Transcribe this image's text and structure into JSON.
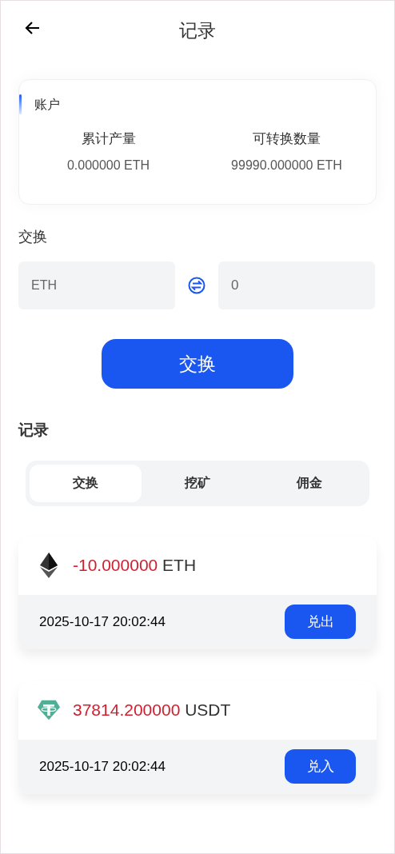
{
  "header": {
    "title": "记录"
  },
  "account": {
    "title": "账户",
    "stats": [
      {
        "label": "累计产量",
        "value": "0.000000 ETH"
      },
      {
        "label": "可转换数量",
        "value": "99990.000000 ETH"
      }
    ]
  },
  "exchange": {
    "label": "交换",
    "from": {
      "value": "ETH"
    },
    "to": {
      "placeholder": "0"
    },
    "button": "交换"
  },
  "records": {
    "title": "记录",
    "tabs": [
      {
        "label": "交换",
        "selected": true
      },
      {
        "label": "挖矿",
        "selected": false
      },
      {
        "label": "佣金",
        "selected": false
      }
    ],
    "items": [
      {
        "kind": "eth",
        "amount": "-10.000000",
        "unit": "ETH",
        "time": "2025-10-17 20:02:44",
        "action": "兑出"
      },
      {
        "kind": "usdt",
        "amount": "37814.200000",
        "unit": "USDT",
        "time": "2025-10-17 20:02:44",
        "action": "兑入"
      }
    ]
  }
}
